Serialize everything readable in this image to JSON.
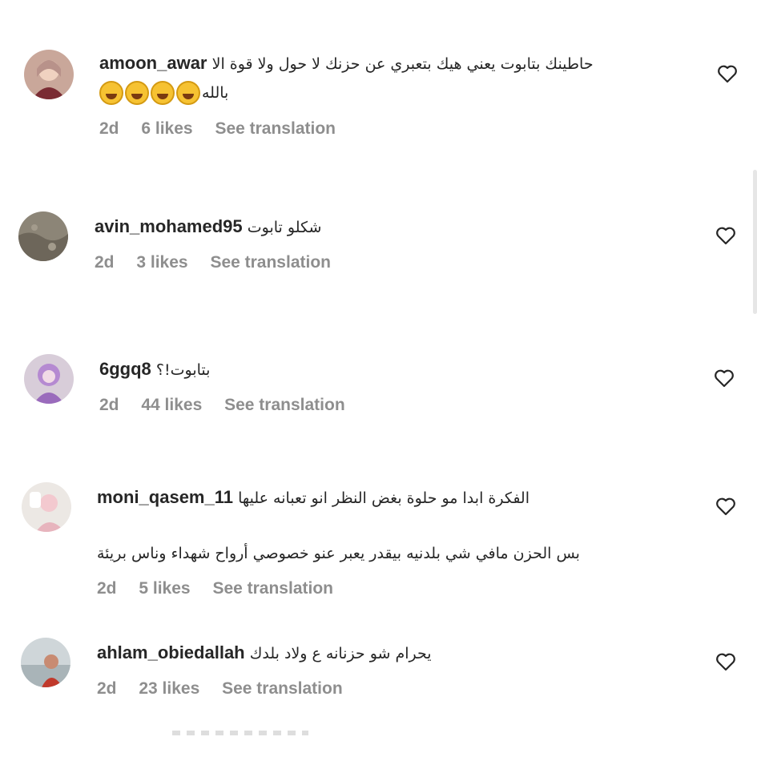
{
  "comments": [
    {
      "username": "amoon_awar",
      "text": "حاطينك بتابوت يعني هيك بتعبري عن حزنك لا حول ولا قوة الا",
      "text_line2": "بالله",
      "emoji_count": 4,
      "emoji_name": "joy-emoji",
      "time": "2d",
      "likes": "6 likes",
      "translate": "See translation"
    },
    {
      "username": "avin_mohamed95",
      "text": "شكلو تابوت",
      "time": "2d",
      "likes": "3 likes",
      "translate": "See translation"
    },
    {
      "username": "6ggq8",
      "text": "بتابوت!؟",
      "time": "2d",
      "likes": "44 likes",
      "translate": "See translation"
    },
    {
      "username": "moni_qasem_11",
      "text": "الفكرة ابدا مو حلوة بغض النظر انو تعبانه عليها",
      "text_line2": "بس الحزن مافي شي بلدنيه بيقدر يعبر عنو خصوصي أرواح شهداء وناس بريئة",
      "time": "2d",
      "likes": "5 likes",
      "translate": "See translation"
    },
    {
      "username": "ahlam_obiedallah",
      "text": "يحرام شو حزنانه ع ولاد بلدك",
      "time": "2d",
      "likes": "23 likes",
      "translate": "See translation"
    }
  ],
  "icons": {
    "like": "heart-outline-icon"
  },
  "colors": {
    "meta": "#8e8e8e",
    "text": "#262626",
    "background": "#ffffff"
  }
}
